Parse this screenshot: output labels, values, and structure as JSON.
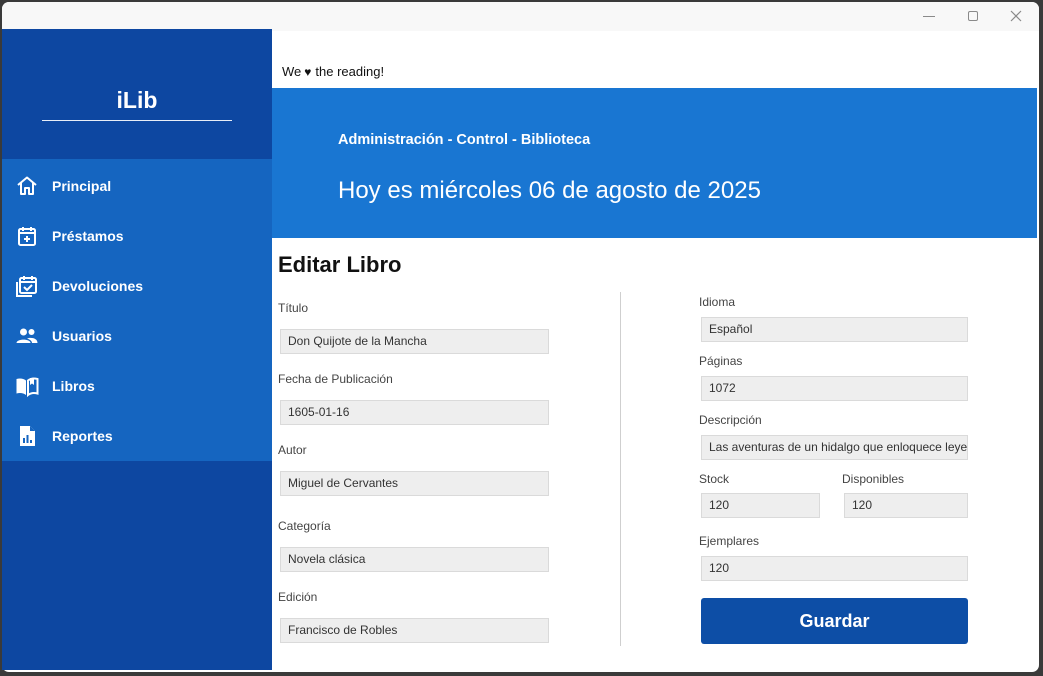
{
  "window": {
    "controls": [
      "minimize",
      "maximize",
      "close"
    ]
  },
  "sidebar": {
    "brand": "iLib",
    "items": [
      {
        "label": "Principal",
        "icon": "home-icon"
      },
      {
        "label": "Préstamos",
        "icon": "calendar-plus-icon"
      },
      {
        "label": "Devoluciones",
        "icon": "calendar-check-icon"
      },
      {
        "label": "Usuarios",
        "icon": "users-icon"
      },
      {
        "label": "Libros",
        "icon": "book-open-icon"
      },
      {
        "label": "Reportes",
        "icon": "report-icon"
      }
    ]
  },
  "header": {
    "tagline_pre": "We",
    "tagline_post": "the reading!",
    "subtitle": "Administración - Control - Biblioteca",
    "date": "Hoy es miércoles 06 de agosto de 2025"
  },
  "form": {
    "title": "Editar Libro",
    "titulo": {
      "label": "Título",
      "value": "Don Quijote de la Mancha"
    },
    "fecha": {
      "label": "Fecha de Publicación",
      "value": "1605-01-16"
    },
    "autor": {
      "label": "Autor",
      "value": "Miguel de Cervantes"
    },
    "categoria": {
      "label": "Categoría",
      "value": "Novela clásica"
    },
    "edicion": {
      "label": "Edición",
      "value": "Francisco de Robles"
    },
    "idioma": {
      "label": "Idioma",
      "value": "Español"
    },
    "paginas": {
      "label": "Páginas",
      "value": "1072"
    },
    "descripcion": {
      "label": "Descripción",
      "value": "Las aventuras de un hidalgo que enloquece leye"
    },
    "stock": {
      "label": "Stock",
      "value": "120"
    },
    "disponibles": {
      "label": "Disponibles",
      "value": "120"
    },
    "ejemplares": {
      "label": "Ejemplares",
      "value": "120"
    },
    "save_label": "Guardar"
  },
  "colors": {
    "sidebar_dark": "#0d47a1",
    "sidebar_nav": "#1565c0",
    "banner": "#1976d2",
    "button": "#0d4ea6",
    "input_bg": "#eeeeee"
  }
}
